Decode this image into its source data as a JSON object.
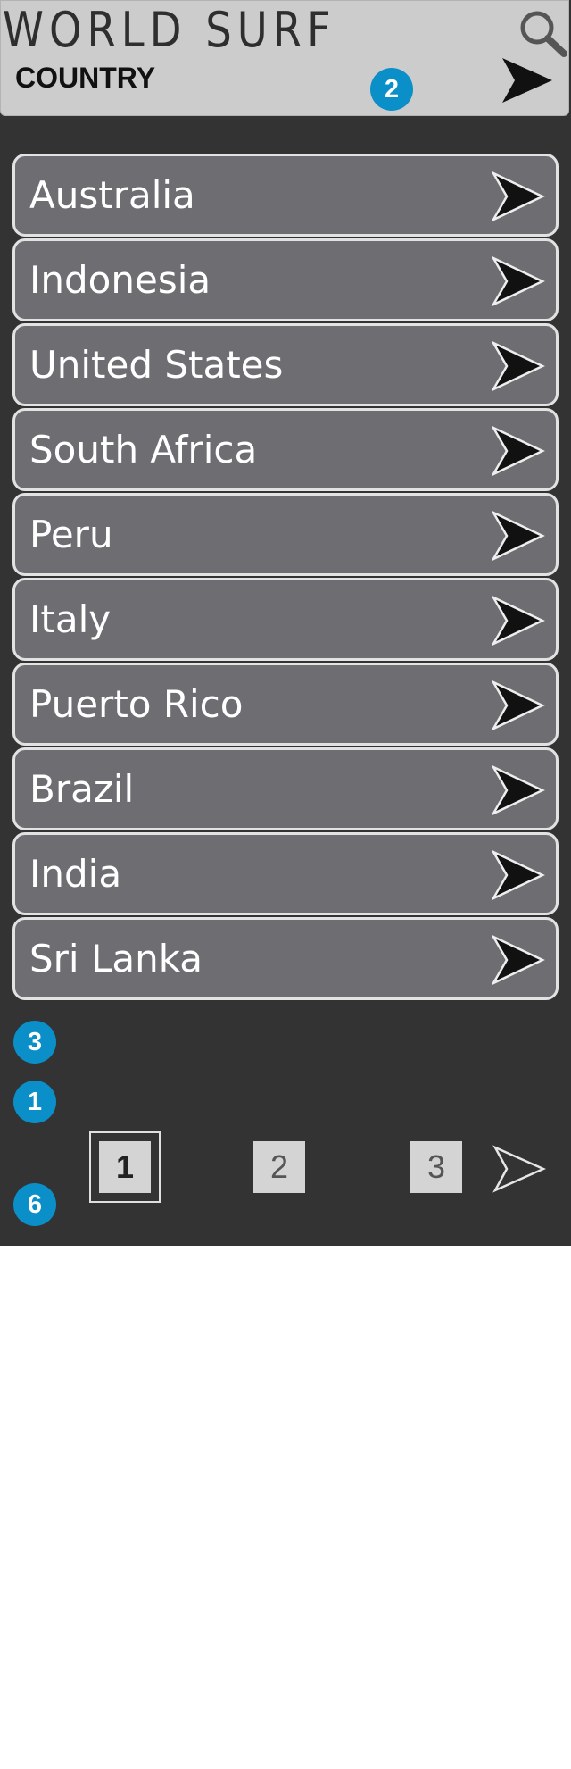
{
  "header": {
    "title": "WORLD SURF",
    "subtitle": "COUNTRY",
    "search_icon": "search-icon",
    "forward_icon": "arrow-right-icon"
  },
  "badges": {
    "header_badge": "2",
    "list_badge_a": "3",
    "list_badge_b": "1",
    "pagination_badge": "6"
  },
  "countries": [
    "Australia",
    "Indonesia",
    "United States",
    "South Africa",
    "Peru",
    "Italy",
    "Puerto Rico",
    "Brazil",
    "India",
    "Sri Lanka"
  ],
  "pagination": {
    "pages": [
      "1",
      "2",
      "3"
    ],
    "current": "1",
    "next_icon": "arrow-right-icon"
  },
  "colors": {
    "background": "#333333",
    "header": "#cccccc",
    "row": "#6e6d72",
    "badge": "#0a8fc9"
  }
}
